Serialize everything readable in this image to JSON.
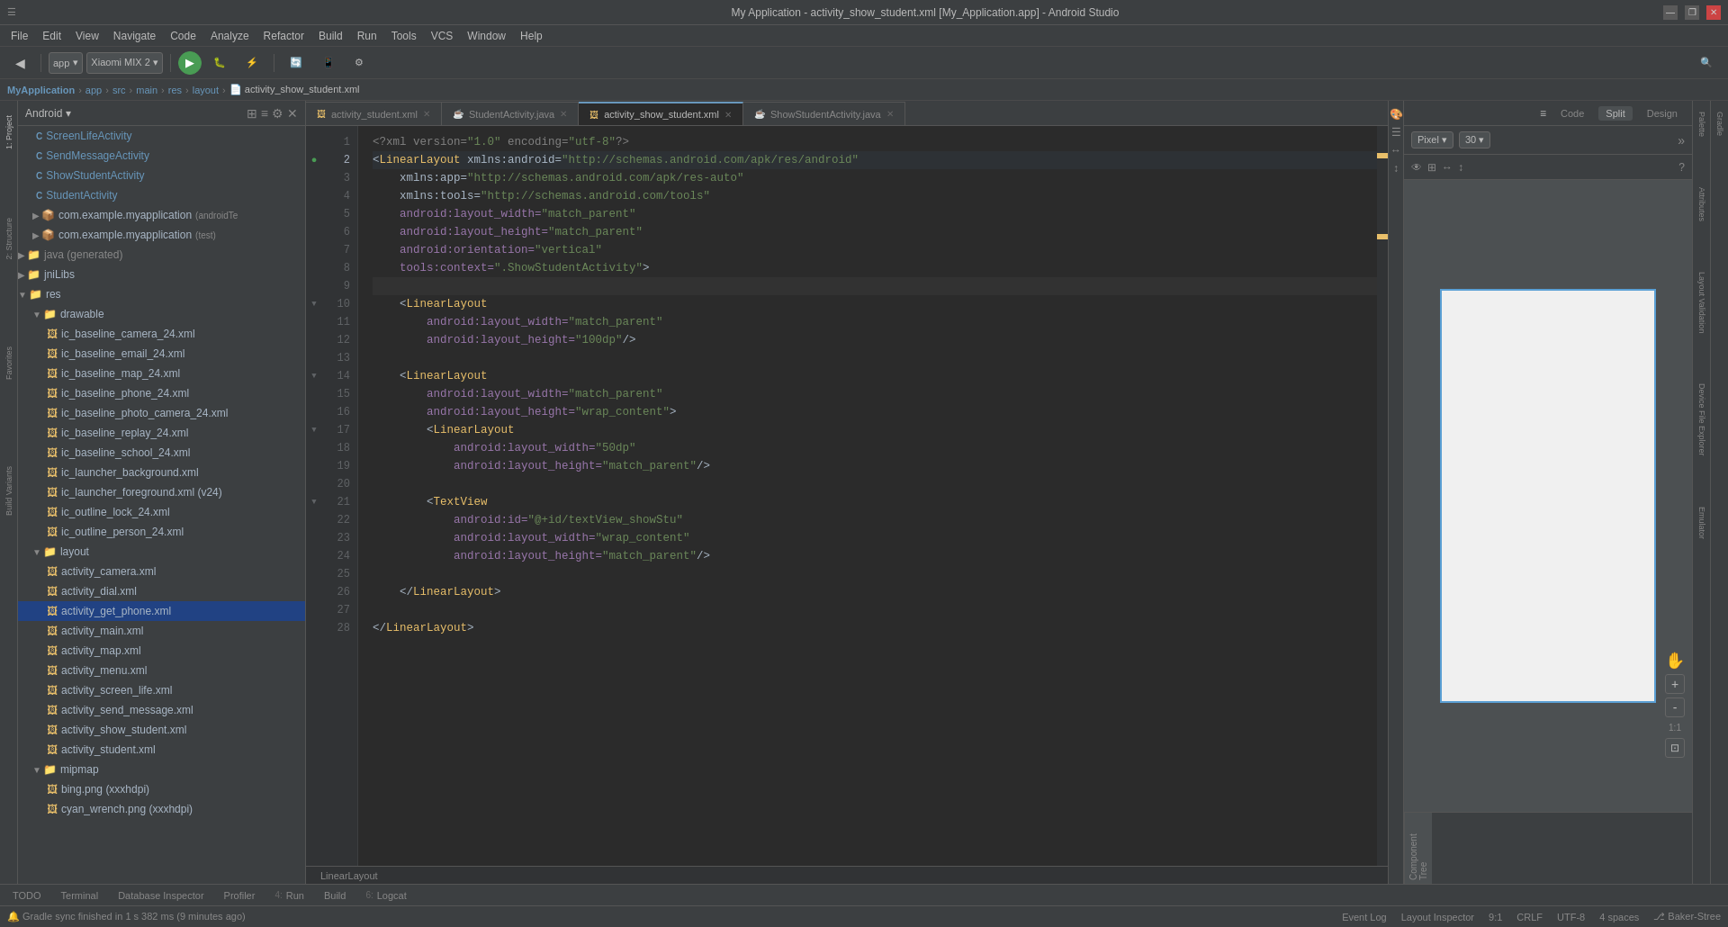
{
  "window": {
    "title": "My Application - activity_show_student.xml [My_Application.app] - Android Studio",
    "controls": [
      "—",
      "❐",
      "✕"
    ]
  },
  "menubar": {
    "items": [
      "File",
      "Edit",
      "View",
      "Navigate",
      "Code",
      "Analyze",
      "Refactor",
      "Build",
      "Run",
      "Tools",
      "VCS",
      "Window",
      "Help"
    ]
  },
  "breadcrumb": {
    "parts": [
      "MyApplication",
      "app",
      "src",
      "main",
      "res",
      "layout",
      "activity_show_student.xml"
    ]
  },
  "project_panel": {
    "title": "Android",
    "dropdown": "▾",
    "tree": [
      {
        "label": "ScreenLifeActivity",
        "type": "class",
        "indent": 1,
        "icon": "C"
      },
      {
        "label": "SendMessageActivity",
        "type": "class",
        "indent": 1,
        "icon": "C"
      },
      {
        "label": "ShowStudentActivity",
        "type": "class",
        "indent": 1,
        "icon": "C"
      },
      {
        "label": "StudentActivity",
        "type": "class",
        "indent": 1,
        "icon": "C"
      },
      {
        "label": "com.example.myapplication",
        "type": "package",
        "indent": 1,
        "badge": "(androidTe",
        "icon": "📦"
      },
      {
        "label": "com.example.myapplication",
        "type": "package",
        "indent": 1,
        "badge": "(test)",
        "icon": "📦"
      },
      {
        "label": "java (generated)",
        "type": "folder",
        "indent": 0,
        "icon": "▶"
      },
      {
        "label": "jniLibs",
        "type": "folder",
        "indent": 0,
        "icon": "▶"
      },
      {
        "label": "res",
        "type": "folder",
        "indent": 0,
        "icon": "▼"
      },
      {
        "label": "drawable",
        "type": "folder",
        "indent": 1,
        "icon": "▼"
      },
      {
        "label": "ic_baseline_camera_24.xml",
        "type": "xml",
        "indent": 2,
        "icon": "🖼"
      },
      {
        "label": "ic_baseline_email_24.xml",
        "type": "xml",
        "indent": 2,
        "icon": "🖼"
      },
      {
        "label": "ic_baseline_map_24.xml",
        "type": "xml",
        "indent": 2,
        "icon": "🖼"
      },
      {
        "label": "ic_baseline_phone_24.xml",
        "type": "xml",
        "indent": 2,
        "icon": "🖼"
      },
      {
        "label": "ic_baseline_photo_camera_24.xml",
        "type": "xml",
        "indent": 2,
        "icon": "🖼"
      },
      {
        "label": "ic_baseline_replay_24.xml",
        "type": "xml",
        "indent": 2,
        "icon": "🖼"
      },
      {
        "label": "ic_baseline_school_24.xml",
        "type": "xml",
        "indent": 2,
        "icon": "🖼"
      },
      {
        "label": "ic_launcher_background.xml",
        "type": "xml",
        "indent": 2,
        "icon": "🖼"
      },
      {
        "label": "ic_launcher_foreground.xml (v24)",
        "type": "xml",
        "indent": 2,
        "icon": "🖼"
      },
      {
        "label": "ic_outline_lock_24.xml",
        "type": "xml",
        "indent": 2,
        "icon": "🖼"
      },
      {
        "label": "ic_outline_person_24.xml",
        "type": "xml",
        "indent": 2,
        "icon": "🖼"
      },
      {
        "label": "layout",
        "type": "folder",
        "indent": 1,
        "icon": "▼"
      },
      {
        "label": "activity_camera.xml",
        "type": "xml",
        "indent": 2,
        "icon": "🖼"
      },
      {
        "label": "activity_dial.xml",
        "type": "xml",
        "indent": 2,
        "icon": "🖼"
      },
      {
        "label": "activity_get_phone.xml",
        "type": "xml",
        "selected": true,
        "indent": 2,
        "icon": "🖼"
      },
      {
        "label": "activity_main.xml",
        "type": "xml",
        "indent": 2,
        "icon": "🖼"
      },
      {
        "label": "activity_map.xml",
        "type": "xml",
        "indent": 2,
        "icon": "🖼"
      },
      {
        "label": "activity_menu.xml",
        "type": "xml",
        "indent": 2,
        "icon": "🖼"
      },
      {
        "label": "activity_screen_life.xml",
        "type": "xml",
        "indent": 2,
        "icon": "🖼"
      },
      {
        "label": "activity_send_message.xml",
        "type": "xml",
        "indent": 2,
        "icon": "🖼"
      },
      {
        "label": "activity_show_student.xml",
        "type": "xml",
        "indent": 2,
        "icon": "🖼"
      },
      {
        "label": "activity_student.xml",
        "type": "xml",
        "indent": 2,
        "icon": "🖼"
      },
      {
        "label": "mipmap",
        "type": "folder",
        "indent": 1,
        "icon": "▼"
      },
      {
        "label": "bing.png (xxxhdpi)",
        "type": "image",
        "indent": 2,
        "icon": "🖼"
      },
      {
        "label": "cyan_wrench.png (xxxhdpi)",
        "type": "image",
        "indent": 2,
        "icon": "🖼"
      }
    ]
  },
  "editor": {
    "tabs": [
      {
        "label": "activity_student.xml",
        "icon": "xml",
        "active": false,
        "modified": false
      },
      {
        "label": "StudentActivity.java",
        "icon": "java",
        "active": false,
        "modified": false
      },
      {
        "label": "activity_show_student.xml",
        "icon": "xml",
        "active": true,
        "modified": false
      },
      {
        "label": "ShowStudentActivity.java",
        "icon": "java",
        "active": false,
        "modified": false
      }
    ],
    "lines": [
      {
        "num": 1,
        "content": "<?xml version=\"1.0\" encoding=\"utf-8\"?>",
        "type": "decl"
      },
      {
        "num": 2,
        "content": "<LinearLayout xmlns:android=\"http://schemas.android.com/apk/res/android\"",
        "type": "tag",
        "modified": true
      },
      {
        "num": 3,
        "content": "    xmlns:app=\"http://schemas.android.com/apk/res-auto\"",
        "type": "attr"
      },
      {
        "num": 4,
        "content": "    xmlns:tools=\"http://schemas.android.com/tools\"",
        "type": "attr"
      },
      {
        "num": 5,
        "content": "    android:layout_width=\"match_parent\"",
        "type": "attr"
      },
      {
        "num": 6,
        "content": "    android:layout_height=\"match_parent\"",
        "type": "attr"
      },
      {
        "num": 7,
        "content": "    android:orientation=\"vertical\"",
        "type": "attr"
      },
      {
        "num": 8,
        "content": "    tools:context=\".ShowStudentActivity\">",
        "type": "attr"
      },
      {
        "num": 9,
        "content": "",
        "type": "empty"
      },
      {
        "num": 10,
        "content": "    <LinearLayout",
        "type": "tag"
      },
      {
        "num": 11,
        "content": "        android:layout_width=\"match_parent\"",
        "type": "attr"
      },
      {
        "num": 12,
        "content": "        android:layout_height=\"100dp\"/>",
        "type": "attr"
      },
      {
        "num": 13,
        "content": "",
        "type": "empty"
      },
      {
        "num": 14,
        "content": "    <LinearLayout",
        "type": "tag"
      },
      {
        "num": 15,
        "content": "        android:layout_width=\"match_parent\"",
        "type": "attr"
      },
      {
        "num": 16,
        "content": "        android:layout_height=\"wrap_content\">",
        "type": "attr"
      },
      {
        "num": 17,
        "content": "        <LinearLayout",
        "type": "tag"
      },
      {
        "num": 18,
        "content": "            android:layout_width=\"50dp\"",
        "type": "attr"
      },
      {
        "num": 19,
        "content": "            android:layout_height=\"match_parent\"/>",
        "type": "attr"
      },
      {
        "num": 20,
        "content": "",
        "type": "empty"
      },
      {
        "num": 21,
        "content": "        <TextView",
        "type": "tag"
      },
      {
        "num": 22,
        "content": "            android:id=\"@+id/textView_showStu\"",
        "type": "attr"
      },
      {
        "num": 23,
        "content": "            android:layout_width=\"wrap_content\"",
        "type": "attr"
      },
      {
        "num": 24,
        "content": "            android:layout_height=\"match_parent\"/>",
        "type": "attr"
      },
      {
        "num": 25,
        "content": "",
        "type": "empty"
      },
      {
        "num": 26,
        "content": "    </LinearLayout>",
        "type": "tag"
      },
      {
        "num": 27,
        "content": "",
        "type": "empty"
      },
      {
        "num": 28,
        "content": "</LinearLayout>",
        "type": "tag"
      }
    ],
    "footer": "LinearLayout"
  },
  "design": {
    "tabs": [
      "Code",
      "Split",
      "Design"
    ],
    "active_tab": "Split",
    "device": "Pixel",
    "api_level": "30",
    "toolbar_icons": [
      "🖼",
      "📐",
      "↔",
      "↕"
    ],
    "zoom_plus": "+",
    "zoom_minus": "-",
    "zoom_reset": "1:1",
    "zoom_fit": "⊡"
  },
  "right_panel": {
    "tabs": [
      "Palette",
      "Attributes",
      "Layout Validation"
    ]
  },
  "bottom_panel": {
    "tabs": [
      {
        "num": "",
        "label": "TODO"
      },
      {
        "num": "",
        "label": "Terminal"
      },
      {
        "num": "",
        "label": "Database Inspector"
      },
      {
        "num": "",
        "label": "Profiler"
      },
      {
        "num": "4:",
        "label": "Run"
      },
      {
        "num": "",
        "label": "Build"
      },
      {
        "num": "6:",
        "label": "Logcat"
      }
    ]
  },
  "status_bar": {
    "left": [
      "Event Log",
      "Layout Inspector"
    ],
    "position": "9:1",
    "encoding": "UTF-8",
    "line_ending": "CRLF",
    "indent": "4 spaces",
    "git": "Baker-Stree",
    "notification": "Gradle sync finished in 1 s 382 ms (9 minutes ago)"
  }
}
